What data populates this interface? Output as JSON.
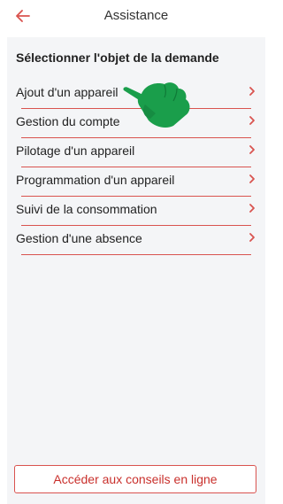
{
  "header": {
    "title": "Assistance",
    "back_icon": "arrow-left-icon"
  },
  "panel": {
    "title": "Sélectionner l'objet de la demande",
    "items": [
      {
        "label": "Ajout d'un appareil"
      },
      {
        "label": "Gestion du compte"
      },
      {
        "label": "Pilotage d'un appareil"
      },
      {
        "label": "Programmation d'un appareil"
      },
      {
        "label": "Suivi de la consommation"
      },
      {
        "label": "Gestion d'une absence"
      }
    ]
  },
  "footer": {
    "button_label": "Accéder aux conseils en ligne"
  },
  "overlay": {
    "icon": "pointing-hand-icon"
  },
  "colors": {
    "accent": "#d9534f",
    "hand": "#1a9e4b",
    "panel_bg": "#f4f5f7"
  }
}
